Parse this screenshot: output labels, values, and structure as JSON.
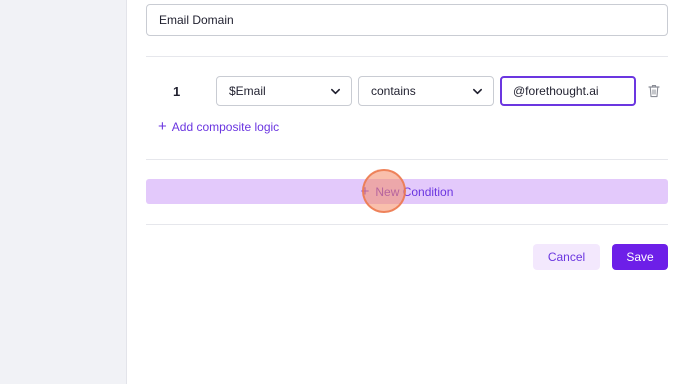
{
  "condition_name": {
    "value": "Email Domain"
  },
  "conditions": [
    {
      "number": "1",
      "field": "$Email",
      "operator": "contains",
      "value": "@forethought.ai"
    }
  ],
  "icons": {
    "chevron": "chevron-down-icon",
    "trash": "trash-icon",
    "plus": "plus-icon"
  },
  "composite_link": {
    "plus": "+",
    "label": "Add composite logic"
  },
  "new_condition": {
    "plus": "+",
    "label": "New Condition"
  },
  "actions": {
    "cancel_label": "Cancel",
    "save_label": "Save"
  },
  "colors": {
    "accent": "#6d1fe8",
    "accent_light": "#e3c9fb",
    "cancel_bg": "#f3e8fd",
    "sidebar_bg": "#f1f2f6"
  }
}
